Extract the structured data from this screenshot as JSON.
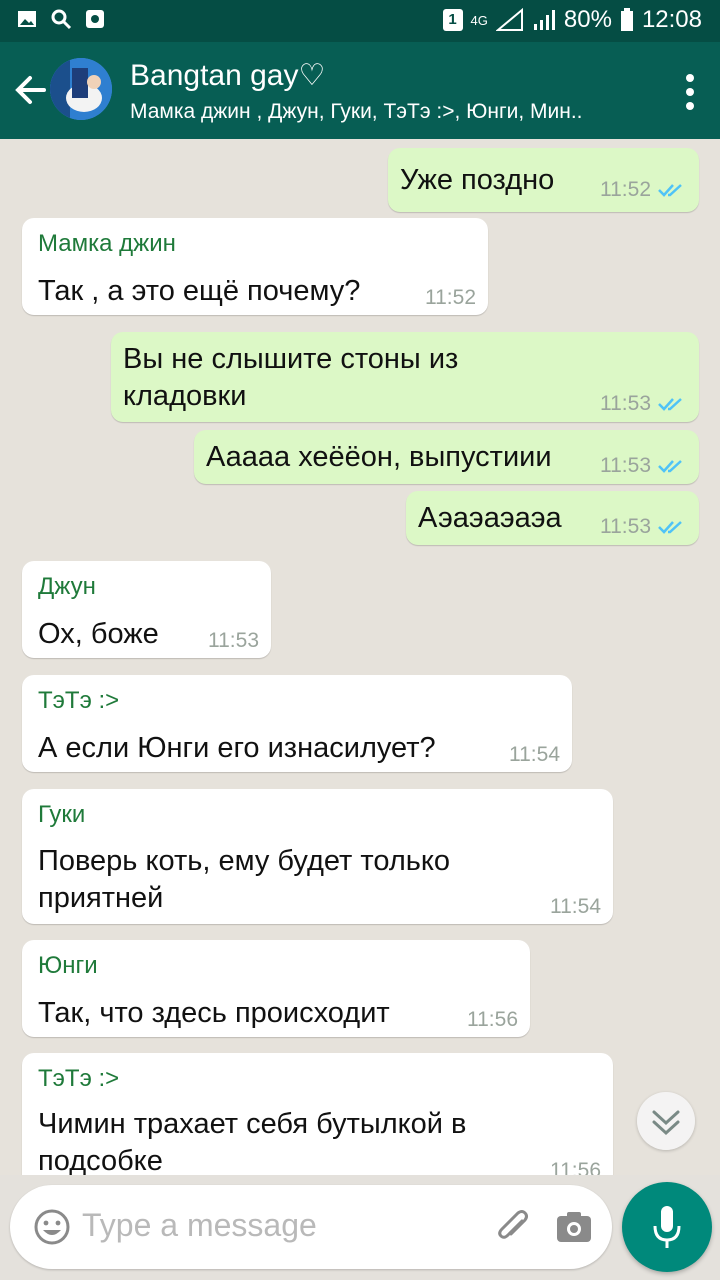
{
  "status_bar": {
    "sim_slot": "1",
    "network": "4G",
    "battery": "80%",
    "time": "12:08"
  },
  "header": {
    "title": "Bangtan gay♡",
    "subtitle": "Мамка джин , Джун, Гуки, ТэТэ :>, Юнги, Мин.."
  },
  "messages": [
    {
      "text": "Уже поздно",
      "time": "11:52"
    },
    {
      "sender": "Мамка джин",
      "text": "Так , а это ещё почему?",
      "time": "11:52"
    },
    {
      "line1": "Вы не слышите стоны из",
      "line2": "кладовки",
      "time": "11:53"
    },
    {
      "text": "Ааааа хеёёон, выпустиии",
      "time": "11:53"
    },
    {
      "text": "Аэаэаэаэа",
      "time": "11:53"
    },
    {
      "sender": "Джун",
      "text": "Ох, боже",
      "time": "11:53"
    },
    {
      "sender": "ТэТэ :>",
      "text": "А если Юнги его изнасилует?",
      "time": "11:54"
    },
    {
      "sender": "Гуки",
      "line1": "Поверь коть, ему будет только",
      "line2": "приятней",
      "time": "11:54"
    },
    {
      "sender": "Юнги",
      "text": "Так, что здесь происходит",
      "time": "11:56"
    },
    {
      "sender": "ТэТэ :>",
      "line1": "Чимин трахает себя бутылкой в",
      "line2": "подсобке",
      "time": "11:56"
    }
  ],
  "composer": {
    "placeholder": "Type a message"
  },
  "colors": {
    "header": "#075e54",
    "status_bar": "#054d44",
    "outgoing_bubble": "#dcf8c6",
    "incoming_bubble": "#ffffff",
    "sender_name": "#1f7a3a",
    "read_ticks": "#4fc3f7",
    "mic_button": "#00897b"
  },
  "icons": [
    "back-arrow-icon",
    "menu-dots-icon",
    "double-check-icon",
    "scroll-down-icon",
    "emoji-icon",
    "attach-icon",
    "camera-icon",
    "mic-icon"
  ]
}
